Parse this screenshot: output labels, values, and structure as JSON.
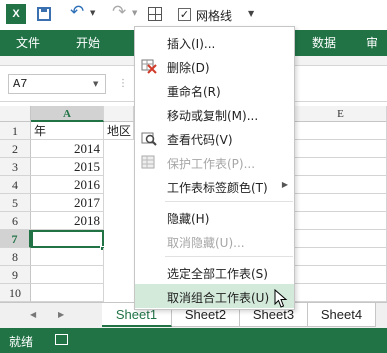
{
  "app": {
    "logo_text": "X",
    "gridlines_label": "网格线",
    "gridlines_checked": "✓"
  },
  "ribbon": {
    "tabs": [
      "文件",
      "开始",
      "数据",
      "审阅"
    ],
    "accent": "#217346"
  },
  "formula_bar": {
    "name_box": "A7"
  },
  "grid": {
    "columns": [
      "A",
      "E"
    ],
    "rows": [
      "1",
      "2",
      "3",
      "4",
      "5",
      "6",
      "7",
      "8",
      "9",
      "10",
      "11"
    ],
    "cells": {
      "a1": "年",
      "b1": "地区",
      "a2": "2014",
      "a3": "2015",
      "a4": "2016",
      "a5": "2017",
      "a6": "2018"
    }
  },
  "sheet_tabs": [
    "Sheet1",
    "Sheet2",
    "Sheet3",
    "Sheet4"
  ],
  "status": {
    "text": "就绪"
  },
  "context_menu": {
    "items": [
      {
        "label": "插入(I)...",
        "enabled": true
      },
      {
        "label": "删除(D)",
        "enabled": true
      },
      {
        "label": "重命名(R)",
        "enabled": true
      },
      {
        "label": "移动或复制(M)...",
        "enabled": true
      },
      {
        "label": "查看代码(V)",
        "enabled": true
      },
      {
        "label": "保护工作表(P)...",
        "enabled": false
      },
      {
        "label": "工作表标签颜色(T)",
        "enabled": true
      },
      {
        "label": "隐藏(H)",
        "enabled": true
      },
      {
        "label": "取消隐藏(U)...",
        "enabled": false
      },
      {
        "label": "选定全部工作表(S)",
        "enabled": true
      },
      {
        "label": "取消组合工作表(U)",
        "enabled": true
      }
    ]
  }
}
